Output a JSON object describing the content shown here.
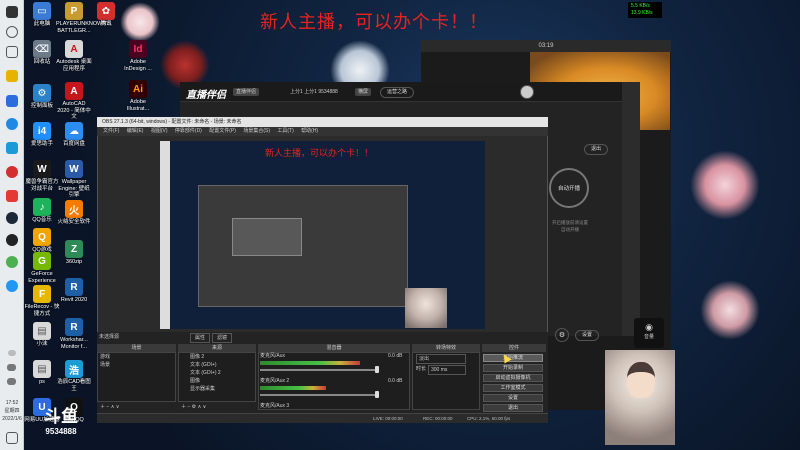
{
  "banner": "新人主播，可以办个卡！！",
  "net_speed": {
    "up": "5.5 KB/s",
    "down": "13.9 KB/s"
  },
  "taskbar": {
    "time": "17:52",
    "weekday": "星期四",
    "date": "2022/1/6"
  },
  "desktop_icons": [
    {
      "label": "此电脑",
      "color": "#3a7bd5",
      "glyph": "▭"
    },
    {
      "label": "回收站",
      "color": "#6c7a89",
      "glyph": "🗑"
    },
    {
      "label": "控制面板",
      "color": "#2c82c9",
      "glyph": "⚙"
    },
    {
      "label": "爱思助手",
      "color": "#1e90ff",
      "glyph": "i4"
    },
    {
      "label": "魔兽争霸官方对战平台",
      "color": "#1a1a1a",
      "glyph": "W"
    },
    {
      "label": "QQ音乐",
      "color": "#20b25a",
      "glyph": "♪"
    },
    {
      "label": "QQ游戏",
      "color": "#f0a500",
      "glyph": "Q"
    },
    {
      "label": "GeForce Experience",
      "color": "#76b900",
      "glyph": "G"
    },
    {
      "label": "FileRecov - 快捷方式",
      "color": "#e6b800",
      "glyph": "F"
    },
    {
      "label": "小沫",
      "color": "#d9d9d9",
      "glyph": "▤"
    },
    {
      "label": "ps",
      "color": "#d9d9d9",
      "glyph": "▤"
    },
    {
      "label": "网易UU加速器",
      "color": "#2d6cdf",
      "glyph": "U"
    },
    {
      "label": "PLAYERUNKNOWN'S BATTLEGR...",
      "color": "#c69b2f",
      "glyph": "P"
    },
    {
      "label": "Autodesk 桌面应用程序",
      "color": "#d9d9d9",
      "glyph": "A"
    },
    {
      "label": "AutoCAD 2020 - 简体中文",
      "color": "#c4161c",
      "glyph": "A"
    },
    {
      "label": "百度网盘",
      "color": "#2d8cf0",
      "glyph": "☁"
    },
    {
      "label": "Wallpaper Engine: 壁纸引擎",
      "color": "#2b5aa8",
      "glyph": "W"
    },
    {
      "label": "火绒安全软件",
      "color": "#f57c00",
      "glyph": "火"
    },
    {
      "label": "360zip",
      "color": "#2e8b57",
      "glyph": "Z"
    },
    {
      "label": "Revit 2020",
      "color": "#1f5fa6",
      "glyph": "R"
    },
    {
      "label": "Revit 2020 - 简体中文",
      "color": "#1f5fa6",
      "glyph": "R"
    },
    {
      "label": "Workshar... Monitor f...",
      "color": "#1f5fa6",
      "glyph": "R"
    },
    {
      "label": "浩辰CAD看图王",
      "color": "#1d9bd7",
      "glyph": "浩"
    },
    {
      "label": "腾讯QQ",
      "color": "#111",
      "glyph": "Q"
    },
    {
      "label": "腾讯",
      "color": "#d32f2f",
      "glyph": "✿"
    },
    {
      "label": "Adobe InDesign ...",
      "color": "#49021f",
      "glyph": "Id"
    },
    {
      "label": "Adobe Illustrat...",
      "color": "#330000",
      "glyph": "Ai"
    }
  ],
  "phone": {
    "time": "03:19",
    "exit_label": "退出"
  },
  "live_app": {
    "logo": "直播伴侣",
    "tag": "直播伴侣",
    "stats": "上分1  上分1  9534888",
    "mode": "横屏",
    "action": "运营之路",
    "start_label": "自动开播",
    "hint_line1": "开启播放前请设置",
    "hint_line2": "自动开播",
    "settings_label": "设置",
    "mic_label": "音量"
  },
  "obs": {
    "title": "OBS 27.1.3 (64-bit, windows) - 配置文件: 未命名 - 场景: 未命名",
    "menu": [
      "文件(F)",
      "编辑(E)",
      "视图(V)",
      "停靠部件(D)",
      "配置文件(P)",
      "场景集合(S)",
      "工具(T)",
      "帮助(H)"
    ],
    "preview_banner": "新人主播，可以办个卡！！",
    "no_source_selected": "未选择源",
    "properties_btn": "属性",
    "filters_btn": "滤镜",
    "docks": {
      "scenes": "场景",
      "sources": "来源",
      "mixer": "混音器",
      "transitions": "转场特效",
      "controls": "控件"
    },
    "scenes": [
      "游戏",
      "场景"
    ],
    "sources": [
      "图像 2",
      "文本 (GDI+)",
      "文本 (GDI+) 2",
      "图像",
      "显示器采集"
    ],
    "mixer": [
      {
        "name": "麦克风/Aux",
        "db": "0.0 dB",
        "level": 0.7
      },
      {
        "name": "麦克风/Aux 2",
        "db": "0.0 dB",
        "level": 0.45
      },
      {
        "name": "麦克风/Aux 3",
        "db": "0.0 dB",
        "level": 0.0
      }
    ],
    "transition": {
      "type": "淡出",
      "duration_label": "时长",
      "duration": "300 ms"
    },
    "controls": [
      "开始推流",
      "开始录制",
      "启动虚拟摄像机",
      "工作室模式",
      "设置",
      "退出"
    ],
    "status": {
      "live": "LIVE: 00:00:00",
      "rec": "REC: 00:00:00",
      "cpu": "CPU: 2.1%, 60.00 fps"
    }
  },
  "douyu_logo": {
    "brand": "斗鱼",
    "room": "9534888"
  }
}
